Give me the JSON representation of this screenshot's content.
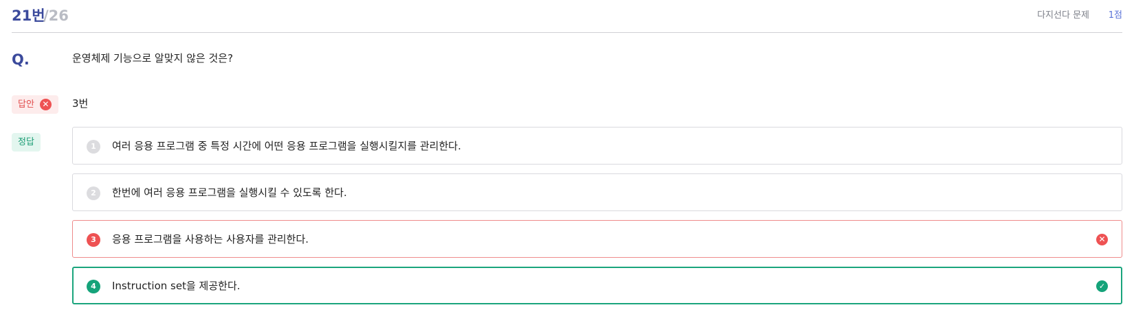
{
  "header": {
    "question_number": "21번",
    "question_total": "/26",
    "question_type": "다지선다 문제",
    "score": "1점"
  },
  "question": {
    "label": "Q.",
    "text": "운영체제 기능으로 알맞지 않은 것은?"
  },
  "answer": {
    "label": "답안",
    "status_icon": "x-circle-icon",
    "value": "3번"
  },
  "correct": {
    "label": "정답"
  },
  "options": [
    {
      "number": "1",
      "text": "여러 응용 프로그램 중 특정 시간에 어떤 응용 프로그램을 실행시킬지를 관리한다.",
      "state": "normal"
    },
    {
      "number": "2",
      "text": "한번에 여러 응용 프로그램을 실행시킬 수 있도록 한다.",
      "state": "normal"
    },
    {
      "number": "3",
      "text": "응용 프로그램을 사용하는 사용자를 관리한다.",
      "state": "selected-wrong",
      "mark_icon": "x-circle-icon"
    },
    {
      "number": "4",
      "text": "Instruction set을 제공한다.",
      "state": "correct",
      "mark_icon": "check-circle-icon"
    }
  ],
  "colors": {
    "accent": "#3b4a9c",
    "wrong": "#ee5253",
    "correct": "#15a37a"
  }
}
